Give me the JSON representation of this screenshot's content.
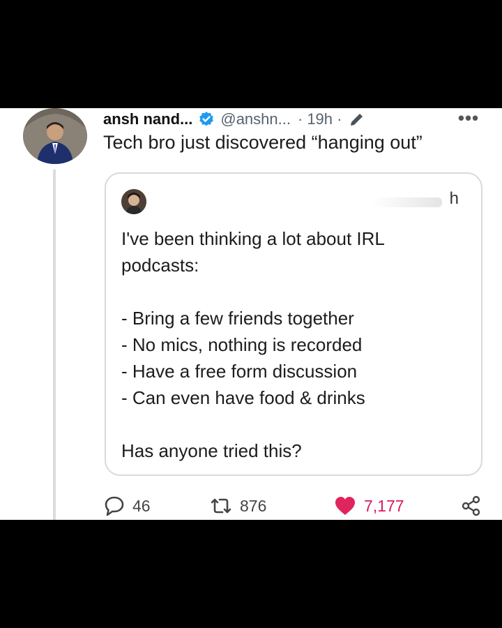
{
  "tweet": {
    "author_name": "ansh nand...",
    "handle": "@anshn...",
    "separator": "·",
    "time": "19h ·",
    "more_label": "•••",
    "text": "Tech bro just discovered “hanging out”"
  },
  "quote": {
    "time": "h",
    "lines": [
      "I've been thinking a lot about IRL",
      "podcasts:"
    ],
    "list": [
      "- Bring a few friends together",
      "- No mics, nothing is recorded",
      "- Have a free form discussion",
      "- Can even have food & drinks"
    ],
    "closing": "Has anyone tried this?"
  },
  "actions": {
    "replies": "46",
    "retweets": "876",
    "likes": "7,177"
  },
  "colors": {
    "like": "#e0245e",
    "verified": "#1d9bf0",
    "thread_line": "#d9dde0"
  }
}
